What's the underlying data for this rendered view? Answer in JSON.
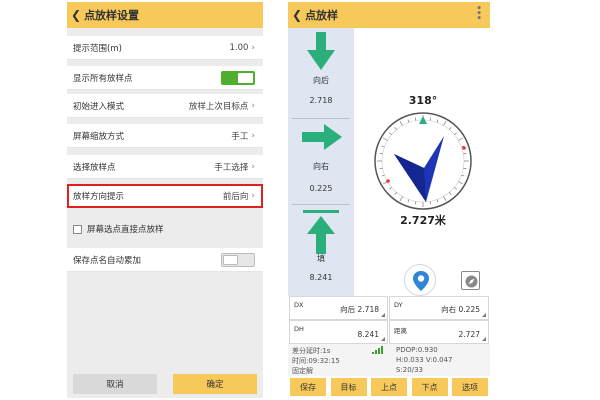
{
  "settings": {
    "title": "点放样设置",
    "rows": [
      {
        "label": "提示范围(m)",
        "value": "1.00"
      },
      {
        "label": "显示所有放样点"
      },
      {
        "label": "初始进入模式",
        "value": "放样上次目标点"
      },
      {
        "label": "屏幕缩放方式",
        "value": "手工"
      },
      {
        "label": "选择放样点",
        "value": "手工选择"
      },
      {
        "label": "放样方向提示",
        "value": "前后向"
      }
    ],
    "checkbox_label": "屏幕选点直接点放样",
    "autoinc_label": "保存点名自动累加",
    "cancel": "取消",
    "ok": "确定",
    "toggle_on_color": "#4fae2d"
  },
  "stakeout": {
    "title": "点放样",
    "directions": [
      {
        "label": "向后",
        "value": "2.718"
      },
      {
        "label": "向右",
        "value": "0.225"
      },
      {
        "label": "填",
        "value": "8.241"
      }
    ],
    "heading": "318°",
    "distance": "2.727米",
    "fields": [
      {
        "key": "DX",
        "value": "向后 2.718"
      },
      {
        "key": "DY",
        "value": "向右 0.225"
      },
      {
        "key": "DH",
        "value": "8.241"
      },
      {
        "key": "距离",
        "value": "2.727"
      }
    ],
    "status": {
      "diff_delay": "差分延时:1s",
      "time": "时间:09:32:15",
      "solution": "固定解",
      "pdop": "PDOP:0.930",
      "hv": "H:0.033  V:0.047",
      "sats": "S:20/33"
    },
    "buttons": [
      "保存",
      "目标",
      "上点",
      "下点",
      "选项"
    ],
    "arrow_color": "#2aae7b",
    "needle_color": "#1f35b8",
    "header_color": "#f7c95a"
  }
}
